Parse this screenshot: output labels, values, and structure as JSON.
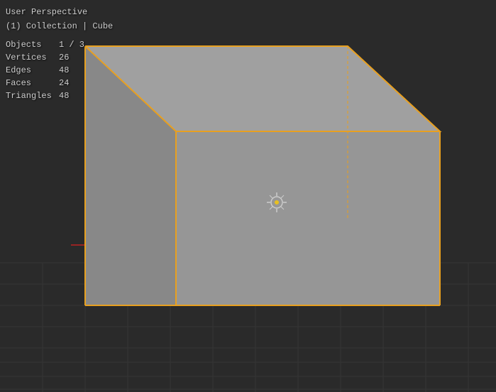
{
  "viewport": {
    "title": "User Perspective",
    "collection_title": "(1) Collection | Cube",
    "background_color": "#2b2b2b",
    "grid_color": "#3a3a3a",
    "edge_color": "#e8a020"
  },
  "stats": {
    "objects_label": "Objects",
    "objects_value": "1 / 3",
    "vertices_label": "Vertices",
    "vertices_value": "26",
    "edges_label": "Edges",
    "edges_value": "48",
    "faces_label": "Faces",
    "faces_value": "24",
    "triangles_label": "Triangles",
    "triangles_value": "48"
  },
  "axes": {
    "x_color": "#cc2222",
    "y_color": "#44aa44",
    "z_color": "#2244cc"
  }
}
